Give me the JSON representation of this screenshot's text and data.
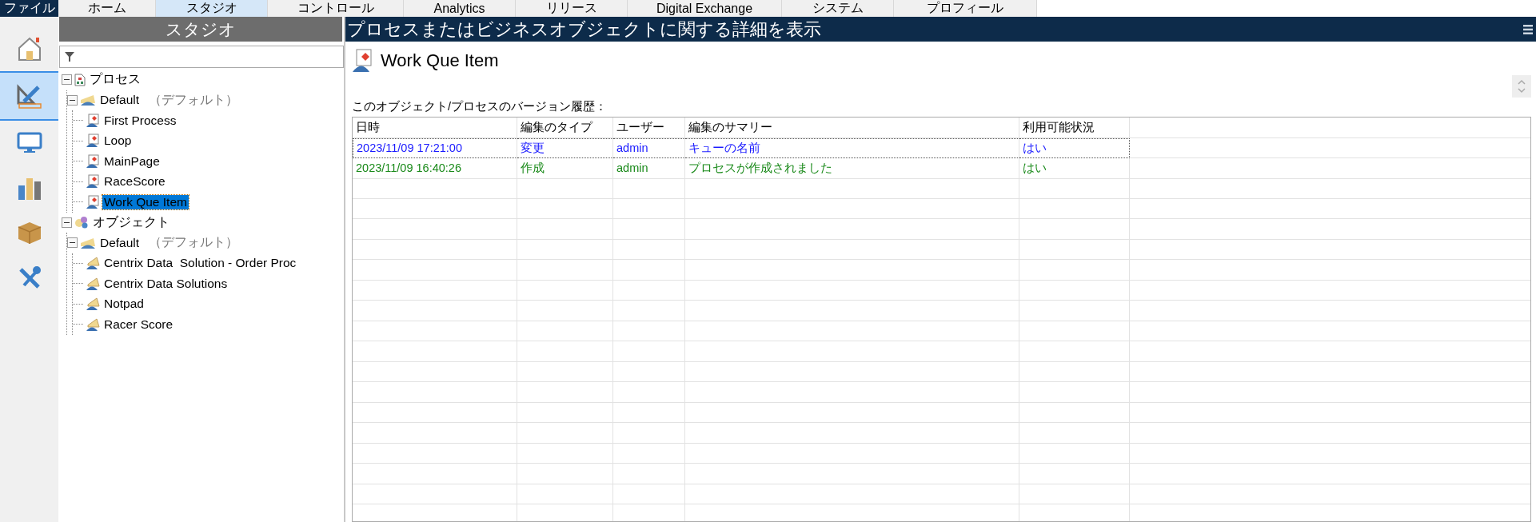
{
  "menu_bar": {
    "file_menu": "ファイル",
    "tabs": [
      {
        "label": "ホーム",
        "selected": false
      },
      {
        "label": "スタジオ",
        "selected": true
      },
      {
        "label": "コントロール",
        "selected": false
      },
      {
        "label": "Analytics",
        "selected": false
      },
      {
        "label": "リリース",
        "selected": false
      },
      {
        "label": "Digital Exchange",
        "selected": false
      },
      {
        "label": "システム",
        "selected": false
      },
      {
        "label": "プロフィール",
        "selected": false
      }
    ]
  },
  "rail": [
    {
      "kind": "home",
      "selected": false
    },
    {
      "kind": "studio",
      "selected": true
    },
    {
      "kind": "monitor",
      "selected": false
    },
    {
      "kind": "chart",
      "selected": false
    },
    {
      "kind": "package",
      "selected": false
    },
    {
      "kind": "tools",
      "selected": false
    }
  ],
  "studio": {
    "title": "スタジオ",
    "tree": [
      {
        "label": "プロセス",
        "kind": "process-root",
        "expanded": true,
        "selected": false,
        "children": [
          {
            "label": "Default",
            "note": "（デフォルト）",
            "kind": "folder",
            "expanded": true,
            "selected": false,
            "children": [
              {
                "label": "First Process",
                "kind": "process",
                "selected": false
              },
              {
                "label": "Loop",
                "kind": "process",
                "selected": false
              },
              {
                "label": "MainPage",
                "kind": "process",
                "selected": false
              },
              {
                "label": "RaceScore",
                "kind": "process",
                "selected": false
              },
              {
                "label": "Work Que Item",
                "kind": "process",
                "selected": true
              }
            ]
          }
        ]
      },
      {
        "label": "オブジェクト",
        "kind": "object-root",
        "expanded": true,
        "selected": false,
        "children": [
          {
            "label": "Default",
            "note": "（デフォルト）",
            "kind": "folder",
            "expanded": true,
            "selected": false,
            "children": [
              {
                "label": "Centrix Data  Solution - Order Proc",
                "kind": "object",
                "selected": false
              },
              {
                "label": "Centrix Data Solutions",
                "kind": "object",
                "selected": false
              },
              {
                "label": "Notpad",
                "kind": "object",
                "selected": false
              },
              {
                "label": "Racer Score",
                "kind": "object",
                "selected": false
              }
            ]
          }
        ]
      }
    ]
  },
  "detail": {
    "header": "プロセスまたはビジネスオブジェクトに関する詳細を表示",
    "item_title": "Work Que Item",
    "history_label": "このオブジェクト/プロセスのバージョン履歴：",
    "table": {
      "columns": [
        "日時",
        "編集のタイプ",
        "ユーザー",
        "編集のサマリー",
        "利用可能状況"
      ],
      "rows": [
        {
          "cells": [
            "2023/11/09 17:21:00",
            "変更",
            "admin",
            "キューの名前",
            "はい"
          ],
          "color": "#1a1aff",
          "selected": true
        },
        {
          "cells": [
            "2023/11/09 16:40:26",
            "作成",
            "admin",
            "プロセスが作成されました",
            "はい"
          ],
          "color": "#1a8a1a",
          "selected": false
        }
      ]
    }
  }
}
